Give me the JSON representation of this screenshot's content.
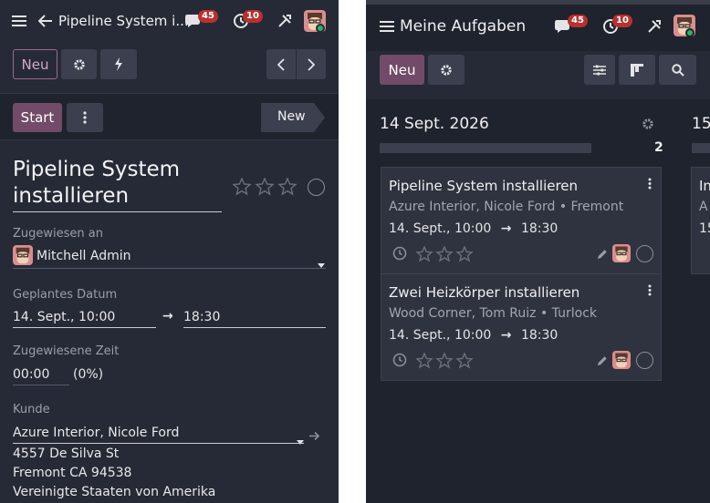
{
  "left": {
    "header": {
      "title": "Pipeline System i...",
      "messages_count": "45",
      "activities_count": "10"
    },
    "toolbar": {
      "new_label": "Neu"
    },
    "statusbar": {
      "start_label": "Start",
      "stage_label": "New"
    },
    "form": {
      "title_line1": "Pipeline System",
      "title_line2": "installieren",
      "assigned_label": "Zugewiesen an",
      "assigned_value": "Mitchell Admin",
      "planned_label": "Geplantes Datum",
      "planned_start": "14. Sept., 10:00",
      "planned_arrow": "→",
      "planned_end": "18:30",
      "allocated_label": "Zugewiesene Zeit",
      "allocated_value": "00:00",
      "allocated_percent": "(0%)",
      "customer_label": "Kunde",
      "customer_value": "Azure Interior, Nicole Ford",
      "address_line1": "4557 De Silva St",
      "address_line2": "Fremont CA 94538",
      "address_line3": "Vereinigte Staaten von Amerika"
    }
  },
  "right": {
    "header": {
      "title": "Meine Aufgaben",
      "messages_count": "45",
      "activities_count": "10"
    },
    "toolbar": {
      "new_label": "Neu"
    },
    "column": {
      "date": "14 Sept. 2026",
      "count": "2",
      "next_date": "15"
    },
    "cards": [
      {
        "title": "Pipeline System installieren",
        "subtitle": "Azure Interior, Nicole Ford • Fremont",
        "start": "14. Sept., 10:00",
        "arrow": "→",
        "end": "18:30"
      },
      {
        "title": "Zwei Heizkörper installieren",
        "subtitle": "Wood Corner, Tom Ruiz • Turlock",
        "start": "14. Sept., 10:00",
        "arrow": "→",
        "end": "18:30"
      }
    ],
    "next_card": {
      "title_start": "In",
      "subtitle_start": "A",
      "date_start": "15"
    }
  },
  "colors": {
    "background": "#262a36",
    "primary": "#714b67",
    "badge": "#b8312e",
    "online": "#28b463"
  }
}
